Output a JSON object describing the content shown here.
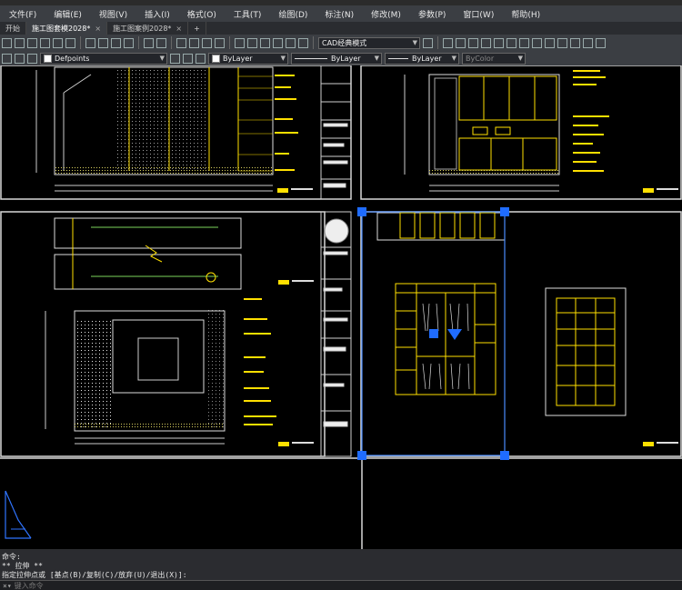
{
  "menu": [
    "文件(F)",
    "编辑(E)",
    "视图(V)",
    "插入(I)",
    "格式(O)",
    "工具(T)",
    "绘图(D)",
    "标注(N)",
    "修改(M)",
    "参数(P)",
    "窗口(W)",
    "帮助(H)"
  ],
  "tabs": [
    {
      "label": "开始",
      "close": ""
    },
    {
      "label": "施工图套模2028*",
      "close": "×"
    },
    {
      "label": "施工图案例2028*",
      "close": "×"
    },
    {
      "label": "+",
      "close": ""
    }
  ],
  "toolbar": {
    "workspace": "CAD经典模式"
  },
  "properties": {
    "layer": "Defpoints",
    "color": "ByLayer",
    "linetype": "ByLayer",
    "lineweight": "ByLayer",
    "plotstyle": "ByColor"
  },
  "command": {
    "lines": [
      "命令:",
      "** 拉伸 **",
      "指定拉伸点或 [基点(B)/复制(C)/放弃(U)/退出(X)]:"
    ],
    "placeholder": "键入命令",
    "prompt_icon": "×▾"
  },
  "colors": {
    "ui_bg": "#3b3e43",
    "canvas": "#000000",
    "accent_yellow": "#ffe000",
    "grip_blue": "#1f6cff",
    "frame_white": "#f0f0f0"
  }
}
